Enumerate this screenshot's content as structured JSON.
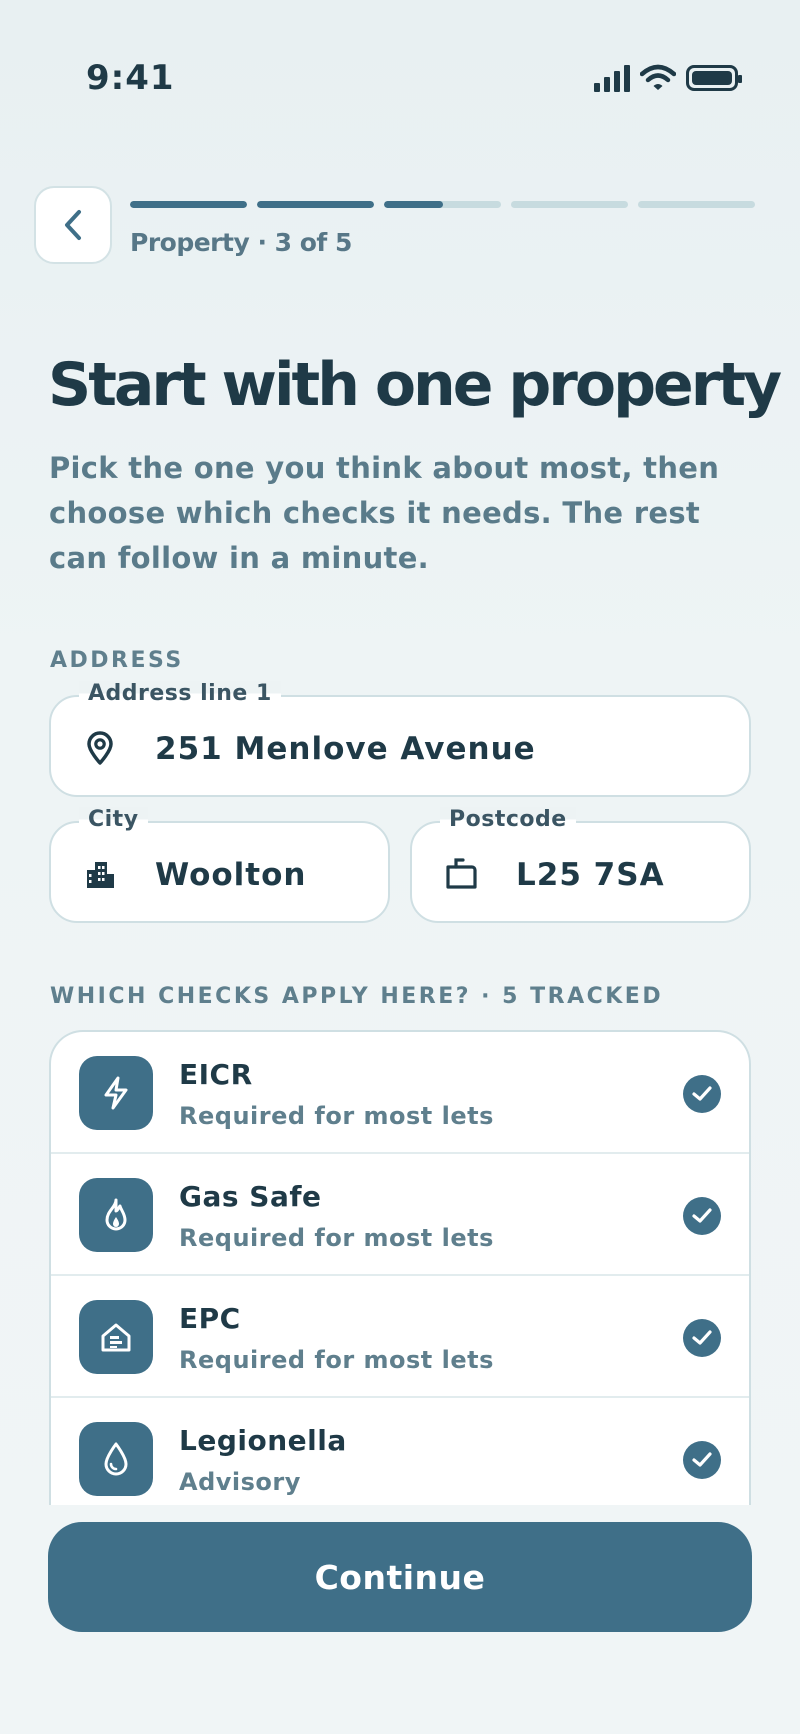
{
  "status_bar": {
    "time": "9:41"
  },
  "header": {
    "step_label": "Property · 3 of 5",
    "progress": [
      1,
      1,
      0.5,
      0,
      0
    ]
  },
  "title": "Start with one property",
  "subtitle": "Pick the one you think about most, then choose which checks it needs. The rest can follow in a minute.",
  "address": {
    "section_label": "ADDRESS",
    "line1": {
      "label": "Address line 1",
      "value": "251 Menlove Avenue",
      "icon": "map-pin-icon"
    },
    "city": {
      "label": "City",
      "value": "Woolton",
      "icon": "buildings-icon"
    },
    "postcode": {
      "label": "Postcode",
      "value": "L25 7SA",
      "icon": "mailbox-icon"
    }
  },
  "checks": {
    "section_label": "WHICH CHECKS APPLY HERE? · 5 TRACKED",
    "items": [
      {
        "name": "EICR",
        "desc": "Required for most lets",
        "icon": "lightning-icon",
        "checked": true
      },
      {
        "name": "Gas Safe",
        "desc": "Required for most lets",
        "icon": "flame-icon",
        "checked": true
      },
      {
        "name": "EPC",
        "desc": "Required for most lets",
        "icon": "home-energy-icon",
        "checked": true
      },
      {
        "name": "Legionella",
        "desc": "Advisory",
        "icon": "water-drop-icon",
        "checked": true
      }
    ]
  },
  "footer": {
    "continue_label": "Continue"
  },
  "colors": {
    "accent": "#3f6f88",
    "text": "#1f3a47",
    "muted": "#5f7f8d"
  }
}
